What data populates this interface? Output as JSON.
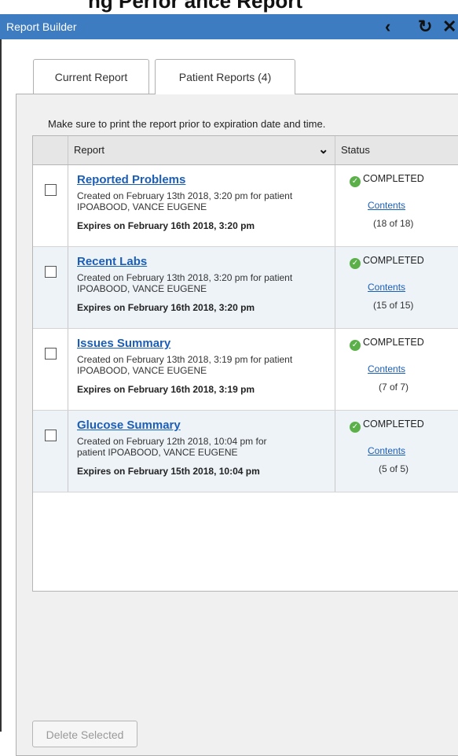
{
  "window": {
    "title": "Report Builder",
    "strip_text": "ng Perfor   ance Report"
  },
  "toolbar": {
    "back_icon_glyph": "‹",
    "refresh_icon_glyph": "↻",
    "close_icon_glyph": "✕"
  },
  "tabs": [
    {
      "label": "Current Report"
    },
    {
      "label": "Patient Reports (4)"
    }
  ],
  "notice": "Make sure to print the report prior to expiration date and time.",
  "table": {
    "col_report": "Report",
    "col_status": "Status",
    "rows": [
      {
        "name": "Reported Problems",
        "created": "Created on February 13th 2018, 3:20 pm for patient IPOABOOD, VANCE EUGENE",
        "expires": "Expires on February 16th 2018, 3:20 pm",
        "status": "COMPLETED",
        "contents": "Contents",
        "count": "(18 of 18)"
      },
      {
        "name": "Recent Labs",
        "created": "Created on February 13th 2018, 3:20 pm for patient IPOABOOD, VANCE EUGENE",
        "expires": "Expires on February 16th 2018, 3:20 pm",
        "status": "COMPLETED",
        "contents": "Contents",
        "count": "(15 of 15)"
      },
      {
        "name": "Issues Summary",
        "created": "Created on February 13th 2018, 3:19 pm for patient IPOABOOD, VANCE EUGENE",
        "expires": "Expires on February 16th 2018, 3:19 pm",
        "status": "COMPLETED",
        "contents": "Contents",
        "count": "(7 of 7)"
      },
      {
        "name": "Glucose Summary",
        "created": "Created on February 12th 2018, 10:04 pm for patient IPOABOOD, VANCE EUGENE",
        "expires": "Expires on February 15th 2018, 10:04 pm",
        "status": "COMPLETED",
        "contents": "Contents",
        "count": "(5 of 5)"
      }
    ]
  },
  "actions": {
    "delete_label": "Delete Selected"
  },
  "colors": {
    "titlebar": "#3d7cc0",
    "link": "#1a5eb8",
    "completed_check": "#5bb04a"
  }
}
